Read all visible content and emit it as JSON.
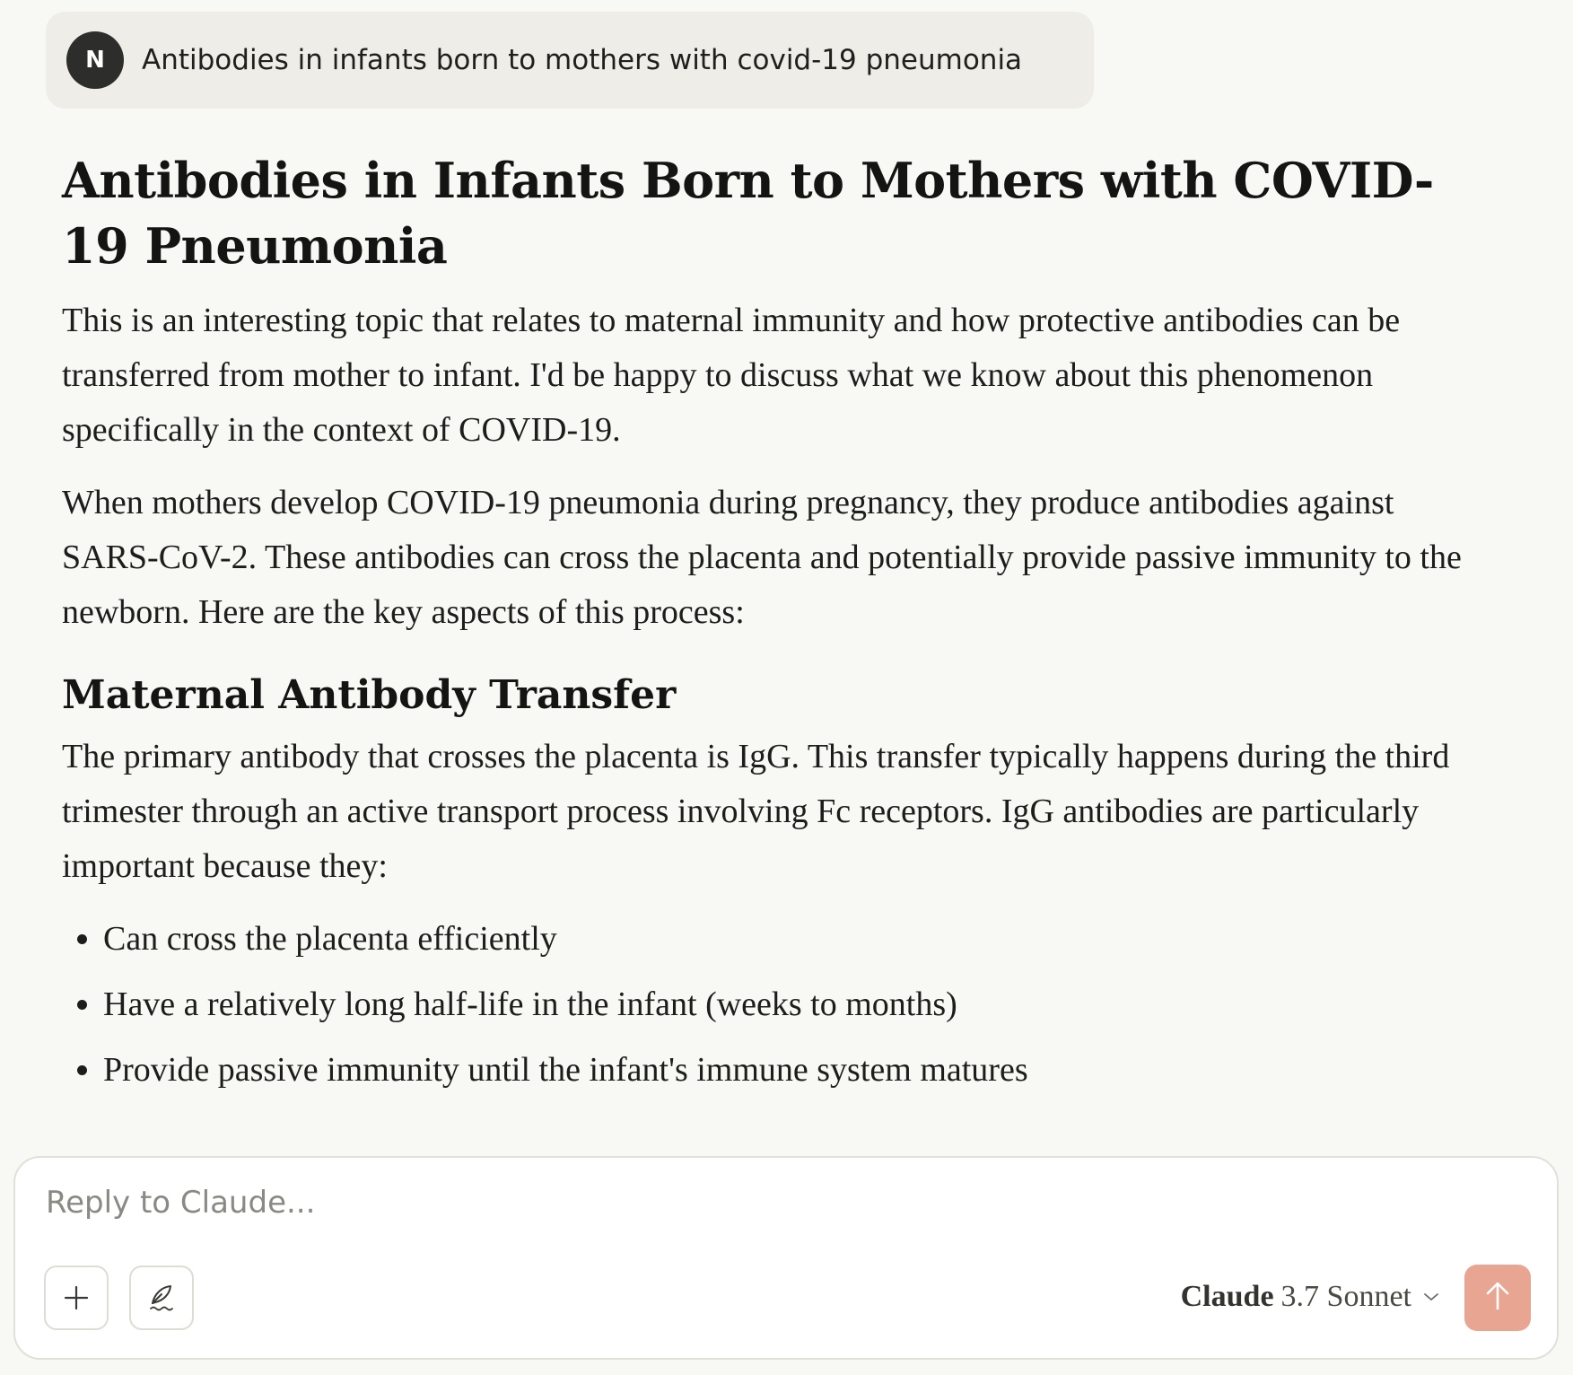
{
  "user_message": {
    "avatar_initial": "N",
    "text": "Antibodies in infants born to mothers with covid-19 pneumonia"
  },
  "response": {
    "title": "Antibodies in Infants Born to Mothers with COVID-19 Pneumonia",
    "paragraphs": [
      "This is an interesting topic that relates to maternal immunity and how protective antibodies can be transferred from mother to infant. I'd be happy to discuss what we know about this phenomenon specifically in the context of COVID-19.",
      "When mothers develop COVID-19 pneumonia during pregnancy, they produce antibodies against SARS-CoV-2. These antibodies can cross the placenta and potentially provide passive immunity to the newborn. Here are the key aspects of this process:"
    ],
    "section_heading": "Maternal Antibody Transfer",
    "section_paragraph": "The primary antibody that crosses the placenta is IgG. This transfer typically happens during the third trimester through an active transport process involving Fc receptors. IgG antibodies are particularly important because they:",
    "bullets": [
      "Can cross the placenta efficiently",
      "Have a relatively long half-life in the infant (weeks to months)",
      "Provide passive immunity until the infant's immune system matures"
    ]
  },
  "composer": {
    "placeholder": "Reply to Claude...",
    "add_icon": "plus-icon",
    "style_icon": "quill-icon",
    "model_brand": "Claude",
    "model_version": "3.7 Sonnet",
    "send_icon": "arrow-up-icon",
    "send_color": "#e8a692"
  }
}
